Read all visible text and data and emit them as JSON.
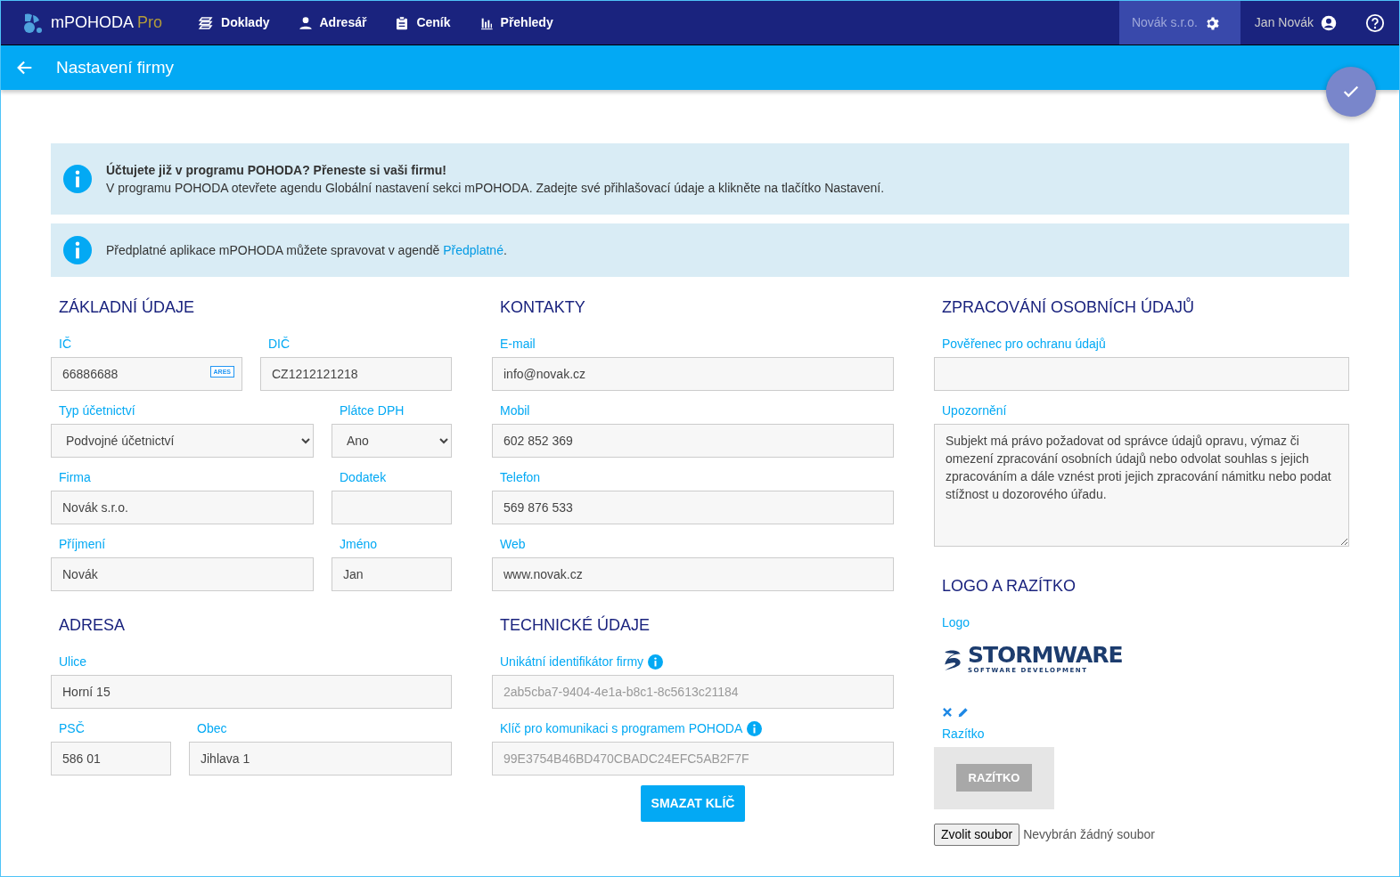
{
  "navbar": {
    "brand": "mPOHODA",
    "brand_suffix": "Pro",
    "items": [
      {
        "label": "Doklady",
        "kind": "documents"
      },
      {
        "label": "Adresář",
        "kind": "person"
      },
      {
        "label": "Ceník",
        "kind": "clipboard"
      },
      {
        "label": "Přehledy",
        "kind": "chart"
      }
    ],
    "company": "Novák s.r.o.",
    "user": "Jan Novák"
  },
  "header": {
    "title": "Nastavení firmy"
  },
  "alerts": [
    {
      "kind": "notice",
      "title": "Účtujete již v programu POHODA? Přeneste si vaši firmu!",
      "text": "V programu POHODA otevřete agendu Globální nastavení sekci mPOHODA. Zadejte své přihlašovací údaje a klikněte na tlačítko Nastavení."
    },
    {
      "kind": "link",
      "text": "Předplatné aplikace mPOHODA můžete spravovat v agendě ",
      "link": "Předplatné",
      "text_after": "."
    }
  ],
  "columns": [
    {
      "sections": [
        {
          "title": "ZÁKLADNÍ ÚDAJE",
          "rows": [
            [
              {
                "label": "IČ",
                "kind": "ares",
                "value": "66886688",
                "badge": "ARES"
              },
              {
                "label": "DIČ",
                "kind": "input",
                "value": "CZ1212121218"
              }
            ],
            [
              {
                "label": "Typ účetnictví",
                "kind": "select",
                "value": "Podvojné účetnictví"
              },
              {
                "label": "Plátce DPH",
                "kind": "select",
                "value": "Ano"
              }
            ],
            [
              {
                "label": "Firma",
                "kind": "input",
                "value": "Novák s.r.o."
              },
              {
                "label": "Dodatek",
                "kind": "input"
              }
            ],
            [
              {
                "label": "Příjmení",
                "kind": "input",
                "value": "Novák"
              },
              {
                "label": "Jméno",
                "kind": "input",
                "value": "Jan"
              }
            ]
          ]
        },
        {
          "title": "ADRESA",
          "rows": [
            [
              {
                "label": "Ulice",
                "kind": "input",
                "value": "Horní 15"
              }
            ],
            [
              {
                "label": "PSČ",
                "kind": "input",
                "value": "586 01"
              },
              {
                "label": "Obec",
                "kind": "input",
                "value": "Jihlava 1"
              }
            ]
          ]
        }
      ]
    },
    {
      "sections": [
        {
          "title": "KONTAKTY",
          "rows": [
            [
              {
                "label": "E-mail",
                "kind": "input",
                "value": "info@novak.cz"
              }
            ],
            [
              {
                "label": "Mobil",
                "kind": "input",
                "value": "602 852 369"
              }
            ],
            [
              {
                "label": "Telefon",
                "kind": "input",
                "value": "569 876 533"
              }
            ],
            [
              {
                "label": "Web",
                "kind": "input",
                "value": "www.novak.cz"
              }
            ]
          ]
        },
        {
          "title": "TECHNICKÉ ÚDAJE",
          "rows": [
            [
              {
                "label": "Unikátní identifikátor firmy",
                "info": true,
                "kind": "input",
                "value": "2ab5cba7-9404-4e1a-b8c1-8c5613c21184",
                "disabled": true
              }
            ],
            [
              {
                "label": "Klíč pro komunikaci s programem POHODA",
                "info": true,
                "kind": "input",
                "value": "99E3754B46BD470CBADC24EFC5AB2F7F",
                "disabled": true
              }
            ]
          ],
          "button": "SMAZAT KLÍČ"
        }
      ]
    },
    {
      "sections": [
        {
          "title": "ZPRACOVÁNÍ OSOBNÍCH ÚDAJŮ",
          "rows": [
            [
              {
                "label": "Pověřenec pro ochranu údajů",
                "kind": "input"
              }
            ],
            [
              {
                "label": "Upozornění",
                "kind": "textarea",
                "value": "Subjekt má právo požadovat od správce údajů opravu, výmaz či omezení zpracování osobních údajů nebo odvolat souhlas s jejich zpracováním a dále vznést proti jejich zpracování námitku nebo podat stížnost u dozorového úřadu."
              }
            ]
          ]
        },
        {
          "title": "LOGO A RAZÍTKO",
          "media": {
            "logo_label": "Logo",
            "wordmark": "STORMWARE",
            "tagline": "SOFTWARE DEVELOPMENT",
            "stamp_label": "Razítko",
            "stamp_text": "RAZÍTKO",
            "file_button": "Zvolit soubor",
            "file_status": "Nevybrán žádný soubor"
          }
        }
      ]
    }
  ]
}
